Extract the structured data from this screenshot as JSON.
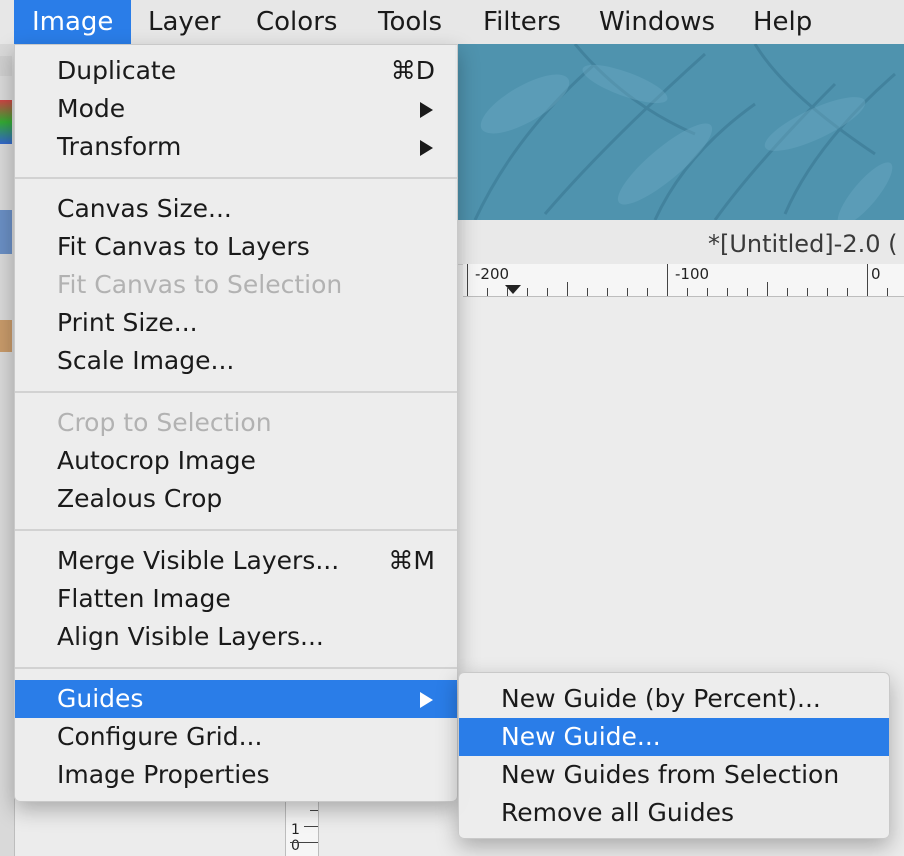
{
  "menubar": {
    "items": [
      {
        "label": "Image",
        "active": true
      },
      {
        "label": "Layer"
      },
      {
        "label": "Colors"
      },
      {
        "label": "Tools"
      },
      {
        "label": "Filters"
      },
      {
        "label": "Windows"
      },
      {
        "label": "Help"
      }
    ]
  },
  "window": {
    "title": "*[Untitled]-2.0 ("
  },
  "ruler": {
    "labels": [
      "-200",
      "-100",
      "0"
    ],
    "vertical_labels": [
      "1",
      "0"
    ]
  },
  "image_menu": {
    "groups": [
      [
        {
          "label": "Duplicate",
          "shortcut": "⌘D"
        },
        {
          "label": "Mode",
          "submenu": true
        },
        {
          "label": "Transform",
          "submenu": true
        }
      ],
      [
        {
          "label": "Canvas Size..."
        },
        {
          "label": "Fit Canvas to Layers"
        },
        {
          "label": "Fit Canvas to Selection",
          "disabled": true
        },
        {
          "label": "Print Size..."
        },
        {
          "label": "Scale Image..."
        }
      ],
      [
        {
          "label": "Crop to Selection",
          "disabled": true
        },
        {
          "label": "Autocrop Image"
        },
        {
          "label": "Zealous Crop"
        }
      ],
      [
        {
          "label": "Merge Visible Layers...",
          "shortcut": "⌘M"
        },
        {
          "label": "Flatten Image"
        },
        {
          "label": "Align Visible Layers..."
        }
      ],
      [
        {
          "label": "Guides",
          "submenu": true,
          "highlighted": true
        },
        {
          "label": "Configure Grid..."
        },
        {
          "label": "Image Properties"
        }
      ]
    ]
  },
  "guides_submenu": {
    "items": [
      {
        "label": "New Guide (by Percent)..."
      },
      {
        "label": "New Guide...",
        "highlighted": true
      },
      {
        "label": "New Guides from Selection"
      },
      {
        "label": "Remove all Guides"
      }
    ]
  },
  "colors": {
    "highlight": "#2a7de8",
    "wallpaper": "#4f93ae",
    "disabled_text": "#b2b2b2"
  }
}
